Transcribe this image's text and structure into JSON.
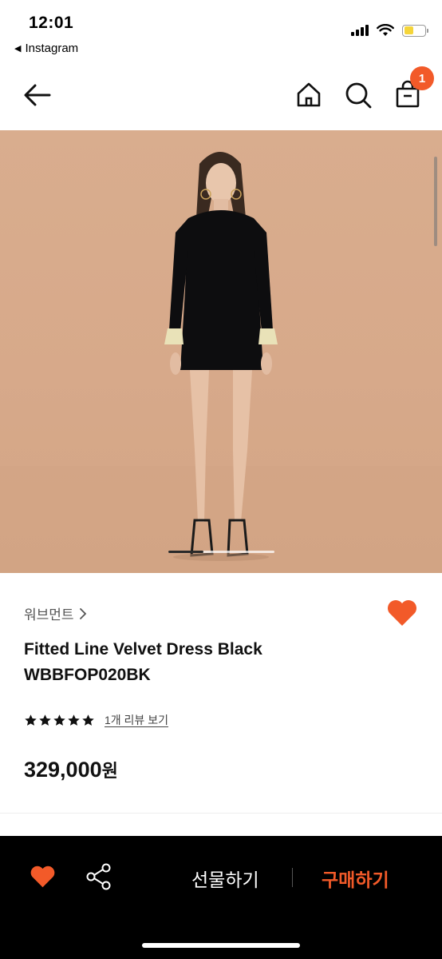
{
  "status_bar": {
    "time": "12:01",
    "back_app": "Instagram",
    "icons": [
      "signal-icon",
      "wifi-icon",
      "battery-icon"
    ]
  },
  "nav": {
    "icons": [
      "arrow-left-icon",
      "home-icon",
      "search-icon",
      "shopping-bag-icon"
    ],
    "cart_badge": "1"
  },
  "product": {
    "image_pages": 3,
    "image_current": 1,
    "brand": "워브먼트",
    "name_line1": "Fitted Line Velvet Dress Black",
    "name_line2": "WBBFOP020BK",
    "rating": 5,
    "review_link": "1개 리뷰 보기",
    "price": "329,000",
    "currency": "원"
  },
  "bottom_bar": {
    "gift_label": "선물하기",
    "buy_label": "구매하기",
    "icons": [
      "heart-icon",
      "share-icon"
    ]
  },
  "colors": {
    "accent": "#f25a29",
    "hero_bg": "#d9ad8e",
    "bottom_bar_bg": "#000000"
  }
}
